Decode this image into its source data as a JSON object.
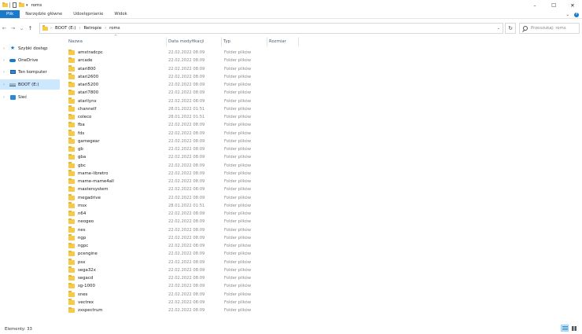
{
  "window": {
    "title": "roms",
    "controls": {
      "minimize": "–",
      "maximize": "☐",
      "close": "✕"
    }
  },
  "quick_access_dropdown": "▾",
  "ribbon": {
    "tabs": [
      "Plik",
      "Narzędzie główne",
      "Udostępnianie",
      "Widok"
    ],
    "collapse_glyph": "⌄",
    "help_glyph": "?"
  },
  "address": {
    "breadcrumbs": [
      "BOOT (E:)",
      "Retropie",
      "roms"
    ],
    "separator": "›",
    "back_glyph": "←",
    "forward_glyph": "→",
    "recent_glyph": "⌄",
    "up_glyph": "↑",
    "history_glyph": "⌄",
    "refresh_glyph": "↻"
  },
  "search": {
    "placeholder": "Przeszukaj: roms"
  },
  "sidebar": {
    "items": [
      {
        "label": "Szybki dostęp",
        "icon": "star-icon",
        "chevron": "›"
      },
      {
        "label": "OneDrive",
        "icon": "cloud-icon",
        "chevron": "›"
      },
      {
        "label": "Ten komputer",
        "icon": "computer-icon",
        "chevron": "›"
      },
      {
        "label": "BOOT (E:)",
        "icon": "drive-icon",
        "chevron": "›",
        "selected": true
      },
      {
        "label": "Sieć",
        "icon": "network-icon",
        "chevron": "›"
      }
    ]
  },
  "columns": {
    "name": "Nazwa",
    "date": "Data modyfikacji",
    "type": "Typ",
    "size": "Rozmiar",
    "sort_indicator": "^"
  },
  "files": [
    {
      "name": "amstradcpc",
      "date": "22.02.2022 08:09",
      "type": "Folder plików"
    },
    {
      "name": "arcade",
      "date": "22.02.2022 08:09",
      "type": "Folder plików"
    },
    {
      "name": "atari800",
      "date": "22.02.2022 08:09",
      "type": "Folder plików"
    },
    {
      "name": "atari2600",
      "date": "22.02.2022 08:09",
      "type": "Folder plików"
    },
    {
      "name": "atari5200",
      "date": "22.02.2022 08:09",
      "type": "Folder plików"
    },
    {
      "name": "atari7800",
      "date": "22.02.2022 08:09",
      "type": "Folder plików"
    },
    {
      "name": "atarilynx",
      "date": "22.02.2022 08:09",
      "type": "Folder plików"
    },
    {
      "name": "channelf",
      "date": "28.01.2022 01:51",
      "type": "Folder plików"
    },
    {
      "name": "coleco",
      "date": "28.01.2022 01:51",
      "type": "Folder plików"
    },
    {
      "name": "fba",
      "date": "22.02.2022 08:09",
      "type": "Folder plików"
    },
    {
      "name": "fds",
      "date": "22.02.2022 08:09",
      "type": "Folder plików"
    },
    {
      "name": "gamegear",
      "date": "22.02.2022 08:09",
      "type": "Folder plików"
    },
    {
      "name": "gb",
      "date": "22.02.2022 08:09",
      "type": "Folder plików"
    },
    {
      "name": "gba",
      "date": "22.02.2022 08:09",
      "type": "Folder plików"
    },
    {
      "name": "gbc",
      "date": "22.02.2022 08:09",
      "type": "Folder plików"
    },
    {
      "name": "mame-libretro",
      "date": "22.02.2022 08:09",
      "type": "Folder plików"
    },
    {
      "name": "mame-mame4all",
      "date": "22.02.2022 08:09",
      "type": "Folder plików"
    },
    {
      "name": "mastersystem",
      "date": "22.02.2022 08:09",
      "type": "Folder plików"
    },
    {
      "name": "megadrive",
      "date": "22.02.2022 08:09",
      "type": "Folder plików"
    },
    {
      "name": "msx",
      "date": "28.01.2022 01:51",
      "type": "Folder plików"
    },
    {
      "name": "n64",
      "date": "22.02.2022 08:09",
      "type": "Folder plików"
    },
    {
      "name": "neogeo",
      "date": "22.02.2022 08:09",
      "type": "Folder plików"
    },
    {
      "name": "nes",
      "date": "22.02.2022 08:09",
      "type": "Folder plików"
    },
    {
      "name": "ngp",
      "date": "22.02.2022 08:09",
      "type": "Folder plików"
    },
    {
      "name": "ngpc",
      "date": "22.02.2022 08:09",
      "type": "Folder plików"
    },
    {
      "name": "pcengine",
      "date": "22.02.2022 08:09",
      "type": "Folder plików"
    },
    {
      "name": "psx",
      "date": "22.02.2022 08:09",
      "type": "Folder plików"
    },
    {
      "name": "sega32x",
      "date": "22.02.2022 08:09",
      "type": "Folder plików"
    },
    {
      "name": "segacd",
      "date": "22.02.2022 08:09",
      "type": "Folder plików"
    },
    {
      "name": "sg-1000",
      "date": "22.02.2022 08:09",
      "type": "Folder plików"
    },
    {
      "name": "snes",
      "date": "22.02.2022 08:09",
      "type": "Folder plików"
    },
    {
      "name": "vectrex",
      "date": "22.02.2022 08:09",
      "type": "Folder plików"
    },
    {
      "name": "zxspectrum",
      "date": "22.02.2022 08:09",
      "type": "Folder plików"
    }
  ],
  "status": {
    "items_count": "Elementy: 33"
  },
  "colors": {
    "accent": "#1979ca",
    "selection": "#cce8ff",
    "folder": "#f7c948",
    "muted_text": "#8a8a8a",
    "header_text": "#4c607a"
  }
}
